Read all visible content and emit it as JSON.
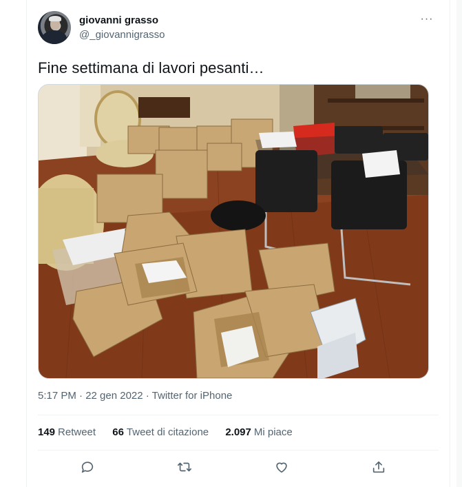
{
  "tweet": {
    "author_name": "giovanni grasso",
    "author_handle": "@_giovannigrasso",
    "more_menu": "···",
    "text": "Fine settimana di lavori pesanti…",
    "timestamp": "5:17 PM · 22 gen 2022 · Twitter for iPhone",
    "stats": {
      "retweets_count": "149",
      "retweets_label": "Retweet",
      "quotes_count": "66",
      "quotes_label": "Tweet di citazione",
      "likes_count": "2.097",
      "likes_label": "Mi piace"
    }
  },
  "actions": [
    {
      "icon": "reply-icon"
    },
    {
      "icon": "retweet-icon"
    },
    {
      "icon": "like-icon"
    },
    {
      "icon": "share-icon"
    }
  ],
  "colors": {
    "text_primary": "#0f1419",
    "text_secondary": "#536471",
    "border": "#eff3f4"
  }
}
